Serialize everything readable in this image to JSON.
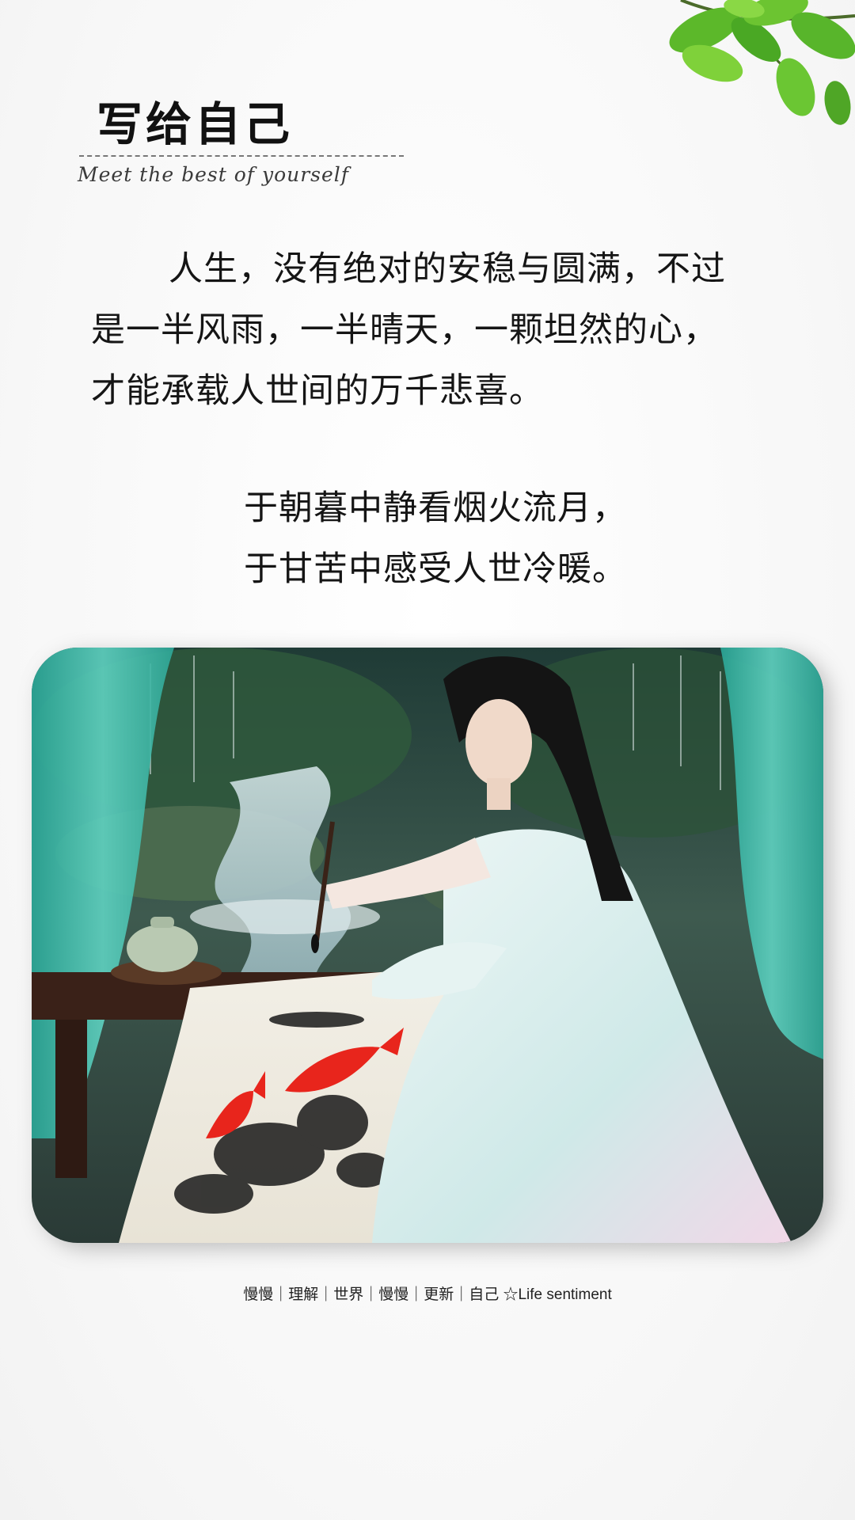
{
  "header": {
    "title": "写给自己",
    "subtitle": "Meet the best of yourself"
  },
  "body": {
    "paragraph1": [
      "人生，没有绝对的安稳与圆满，不过",
      "是一半风雨，一半晴天，一颗坦然的心，",
      "才能承载人世间的万千悲喜。"
    ],
    "paragraph2": [
      "于朝暮中静看烟火流月，",
      "于甘苦中感受人世冷暖。"
    ]
  },
  "image": {
    "subject": "woman in pale teal hanfu painting red koi on a scroll beside a rainy stream",
    "colors": {
      "curtain": "#3fb9a7",
      "koi": "#e8251c",
      "dress": "#dcefee",
      "table": "#3a2118"
    }
  },
  "caption": {
    "text": "慢慢｜理解｜世界｜慢慢｜更新｜自己 ☆Life sentiment"
  },
  "decoration": {
    "corner_icon": "green-leaves"
  }
}
